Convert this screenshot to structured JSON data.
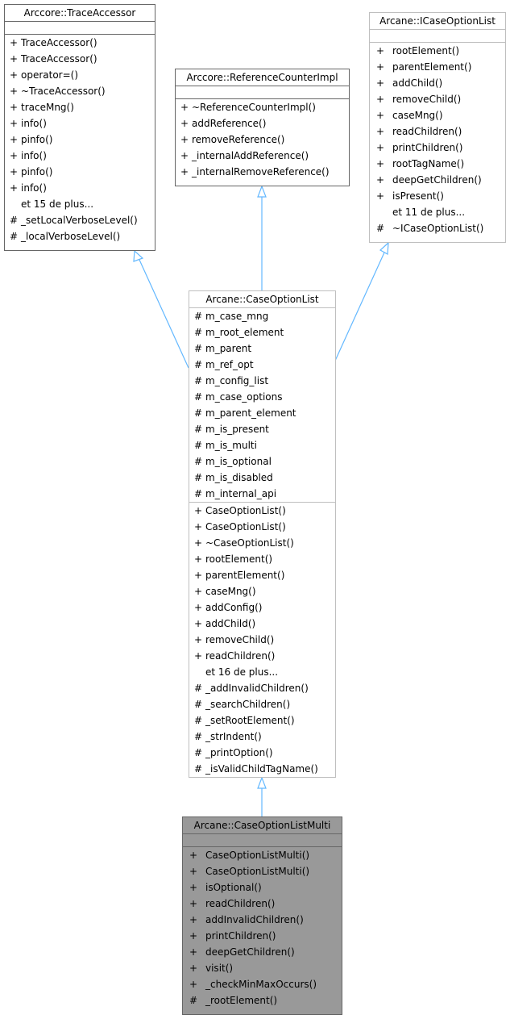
{
  "diagram": {
    "edge_color": "#63b8ff",
    "classes": {
      "trace_accessor": {
        "name": "Arccore::TraceAccessor",
        "attributes": [],
        "members": [
          {
            "vis": "+",
            "name": "TraceAccessor()"
          },
          {
            "vis": "+",
            "name": "TraceAccessor()"
          },
          {
            "vis": "+",
            "name": "operator=()"
          },
          {
            "vis": "+",
            "name": "~TraceAccessor()"
          },
          {
            "vis": "+",
            "name": "traceMng()"
          },
          {
            "vis": "+",
            "name": "info()"
          },
          {
            "vis": "+",
            "name": "pinfo()"
          },
          {
            "vis": "+",
            "name": "info()"
          },
          {
            "vis": "+",
            "name": "pinfo()"
          },
          {
            "vis": "+",
            "name": "info()"
          },
          {
            "vis": "",
            "name": "et 15 de plus..."
          },
          {
            "vis": "#",
            "name": "_setLocalVerboseLevel()"
          },
          {
            "vis": "#",
            "name": "_localVerboseLevel()"
          }
        ]
      },
      "reference_counter_impl": {
        "name": "Arccore::ReferenceCounterImpl",
        "attributes": [],
        "members": [
          {
            "vis": "+",
            "name": "~ReferenceCounterImpl()"
          },
          {
            "vis": "+",
            "name": "addReference()"
          },
          {
            "vis": "+",
            "name": "removeReference()"
          },
          {
            "vis": "+",
            "name": "_internalAddReference()"
          },
          {
            "vis": "+",
            "name": "_internalRemoveReference()"
          }
        ]
      },
      "icase_option_list": {
        "name": "Arcane::ICaseOptionList",
        "attributes": [],
        "members": [
          {
            "vis": "+",
            "name": "rootElement()"
          },
          {
            "vis": "+",
            "name": "parentElement()"
          },
          {
            "vis": "+",
            "name": "addChild()"
          },
          {
            "vis": "+",
            "name": "removeChild()"
          },
          {
            "vis": "+",
            "name": "caseMng()"
          },
          {
            "vis": "+",
            "name": "readChildren()"
          },
          {
            "vis": "+",
            "name": "printChildren()"
          },
          {
            "vis": "+",
            "name": "rootTagName()"
          },
          {
            "vis": "+",
            "name": "deepGetChildren()"
          },
          {
            "vis": "+",
            "name": "isPresent()"
          },
          {
            "vis": "",
            "name": "et 11 de plus..."
          },
          {
            "vis": "#",
            "name": "~ICaseOptionList()"
          }
        ]
      },
      "case_option_list": {
        "name": "Arcane::CaseOptionList",
        "attributes": [
          {
            "vis": "#",
            "name": "m_case_mng"
          },
          {
            "vis": "#",
            "name": "m_root_element"
          },
          {
            "vis": "#",
            "name": "m_parent"
          },
          {
            "vis": "#",
            "name": "m_ref_opt"
          },
          {
            "vis": "#",
            "name": "m_config_list"
          },
          {
            "vis": "#",
            "name": "m_case_options"
          },
          {
            "vis": "#",
            "name": "m_parent_element"
          },
          {
            "vis": "#",
            "name": "m_is_present"
          },
          {
            "vis": "#",
            "name": "m_is_multi"
          },
          {
            "vis": "#",
            "name": "m_is_optional"
          },
          {
            "vis": "#",
            "name": "m_is_disabled"
          },
          {
            "vis": "#",
            "name": "m_internal_api"
          }
        ],
        "members": [
          {
            "vis": "+",
            "name": "CaseOptionList()"
          },
          {
            "vis": "+",
            "name": "CaseOptionList()"
          },
          {
            "vis": "+",
            "name": "~CaseOptionList()"
          },
          {
            "vis": "+",
            "name": "rootElement()"
          },
          {
            "vis": "+",
            "name": "parentElement()"
          },
          {
            "vis": "+",
            "name": "caseMng()"
          },
          {
            "vis": "+",
            "name": "addConfig()"
          },
          {
            "vis": "+",
            "name": "addChild()"
          },
          {
            "vis": "+",
            "name": "removeChild()"
          },
          {
            "vis": "+",
            "name": "readChildren()"
          },
          {
            "vis": "",
            "name": "et 16 de plus..."
          },
          {
            "vis": "#",
            "name": "_addInvalidChildren()"
          },
          {
            "vis": "#",
            "name": "_searchChildren()"
          },
          {
            "vis": "#",
            "name": "_setRootElement()"
          },
          {
            "vis": "#",
            "name": "_strIndent()"
          },
          {
            "vis": "#",
            "name": "_printOption()"
          },
          {
            "vis": "#",
            "name": "_isValidChildTagName()"
          }
        ]
      },
      "case_option_list_multi": {
        "name": "Arcane::CaseOptionListMulti",
        "attributes": [],
        "members": [
          {
            "vis": "+",
            "name": "CaseOptionListMulti()"
          },
          {
            "vis": "+",
            "name": "CaseOptionListMulti()"
          },
          {
            "vis": "+",
            "name": "isOptional()"
          },
          {
            "vis": "+",
            "name": "readChildren()"
          },
          {
            "vis": "+",
            "name": "addInvalidChildren()"
          },
          {
            "vis": "+",
            "name": "printChildren()"
          },
          {
            "vis": "+",
            "name": "deepGetChildren()"
          },
          {
            "vis": "+",
            "name": "visit()"
          },
          {
            "vis": "+",
            "name": "_checkMinMaxOccurs()"
          },
          {
            "vis": "#",
            "name": "_rootElement()"
          }
        ]
      }
    },
    "inheritance": [
      {
        "from": "Arcane::CaseOptionList",
        "to": "Arccore::TraceAccessor"
      },
      {
        "from": "Arcane::CaseOptionList",
        "to": "Arccore::ReferenceCounterImpl"
      },
      {
        "from": "Arcane::CaseOptionList",
        "to": "Arcane::ICaseOptionList"
      },
      {
        "from": "Arcane::CaseOptionListMulti",
        "to": "Arcane::CaseOptionList"
      }
    ]
  }
}
